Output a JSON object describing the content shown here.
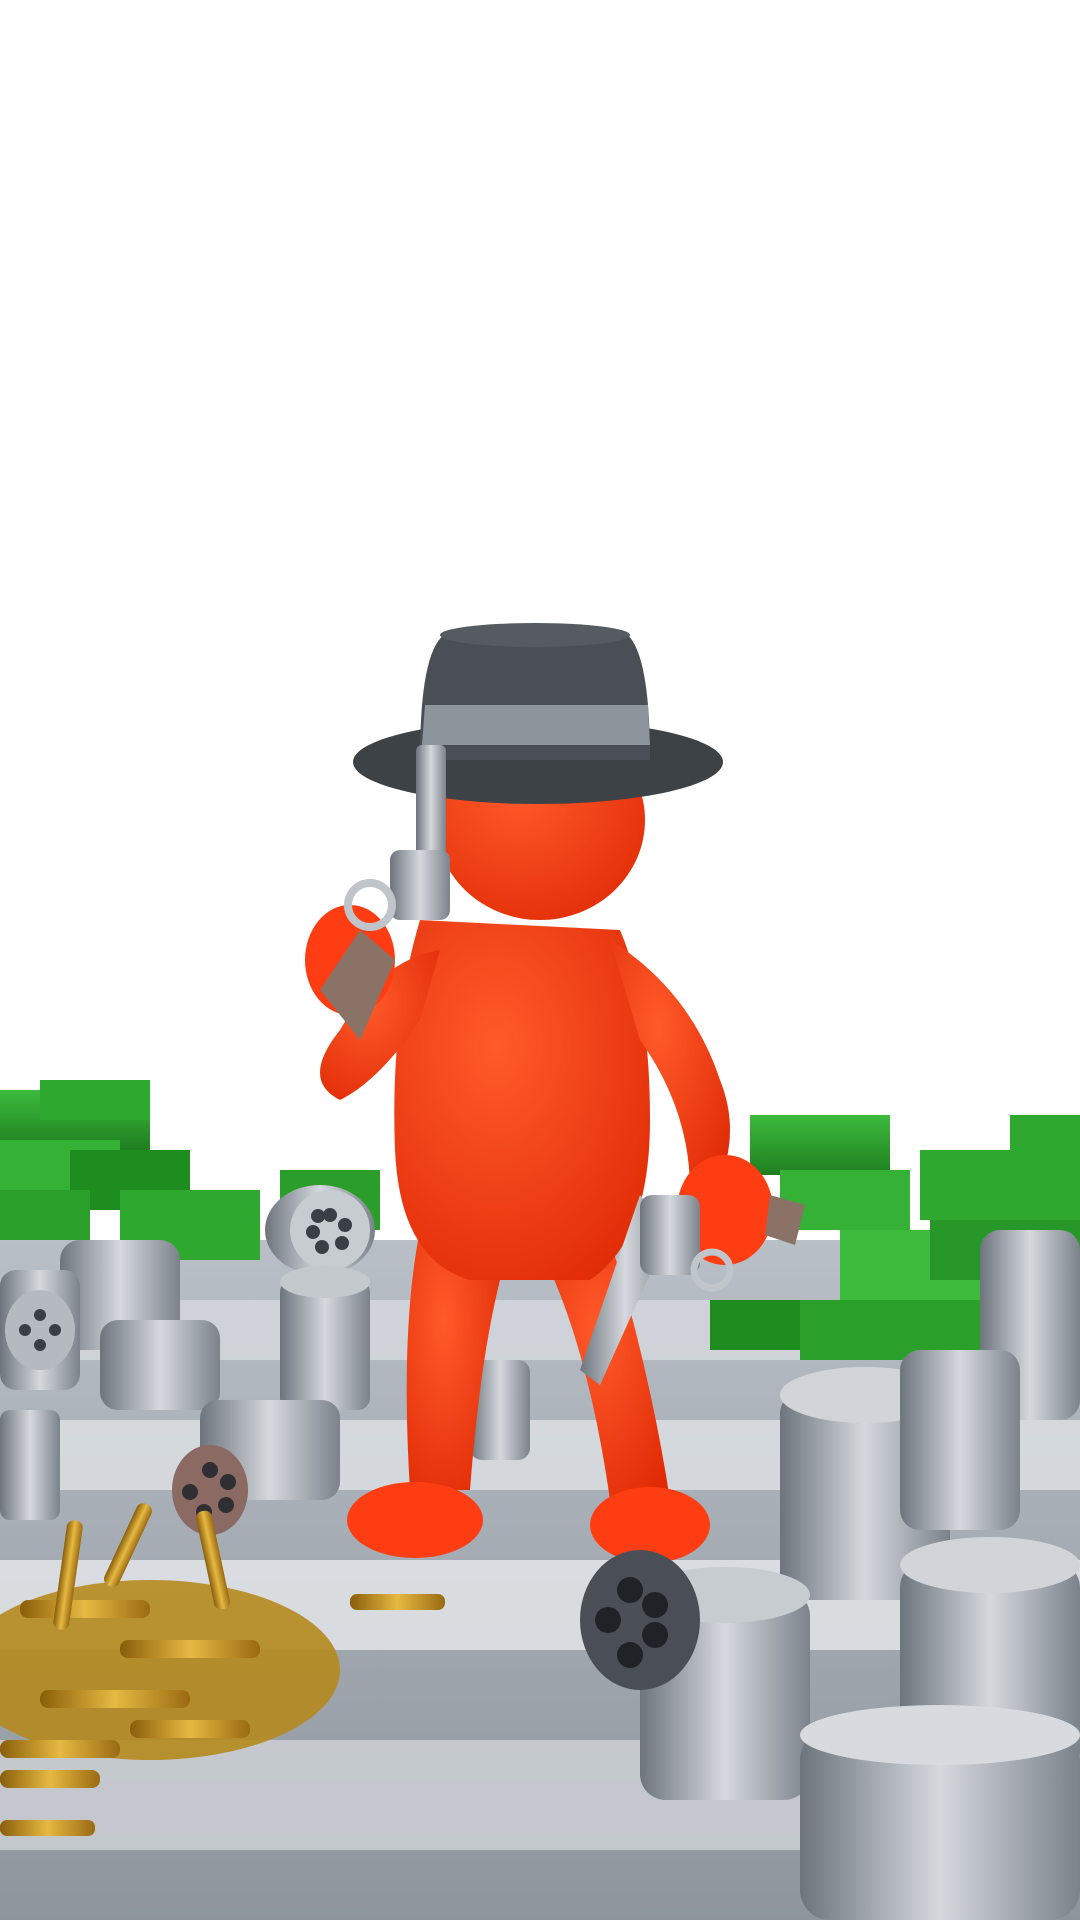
{
  "scene": {
    "background_color": "#ffffff",
    "character": {
      "name": "red-gunslinger",
      "body_color": "#ff3d12",
      "hat_color": "#4a4f55",
      "hat_band_color": "#8c949c",
      "props": [
        "revolver-left-hand",
        "revolver-right-hand"
      ]
    },
    "floor": {
      "colors": [
        "#c9cdd2",
        "#e6e8eb",
        "#9aa1a9"
      ]
    },
    "props": {
      "cash_color": "#2ea82e",
      "cash_dark_color": "#1f7f20",
      "bullet_color": "#c9961a",
      "cylinder_color": "#9ea5ad"
    }
  }
}
